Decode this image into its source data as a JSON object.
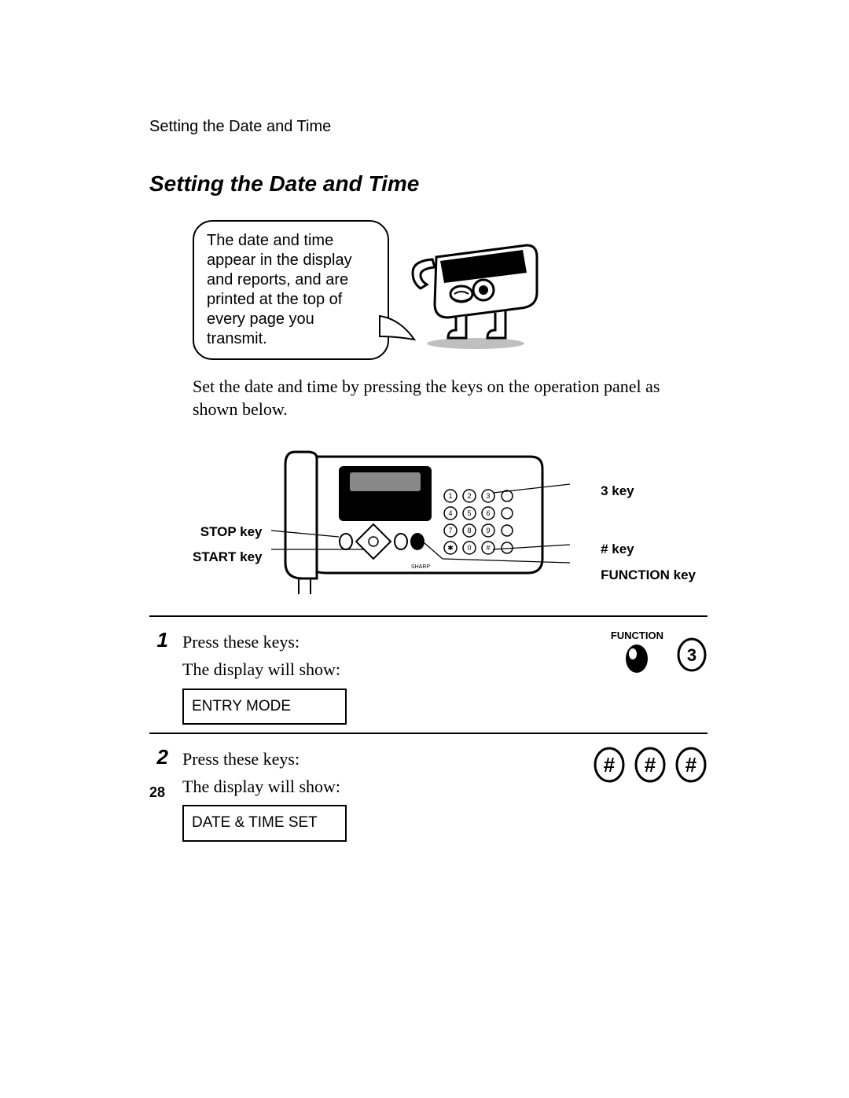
{
  "running_head": "Setting the Date and Time",
  "section_title": "Setting the Date and Time",
  "callout_text": "The date and time appear in the display and reports, and are printed at the top of every page you transmit.",
  "body_text": "Set the date and time by pressing the keys on the operation panel as shown below.",
  "panel": {
    "left_labels": {
      "stop": "STOP key",
      "start": "START key"
    },
    "right_labels": {
      "three": "3 key",
      "hash": "# key",
      "function": "FUNCTION key"
    }
  },
  "steps": [
    {
      "num": "1",
      "press": "Press these keys:",
      "show": "The display will show:",
      "display": "ENTRY MODE",
      "func_label": "FUNCTION",
      "key_digit": "3"
    },
    {
      "num": "2",
      "press": "Press these keys:",
      "show": "The display will show:",
      "display": "DATE & TIME SET",
      "hash": "#"
    }
  ],
  "page_number": "28"
}
